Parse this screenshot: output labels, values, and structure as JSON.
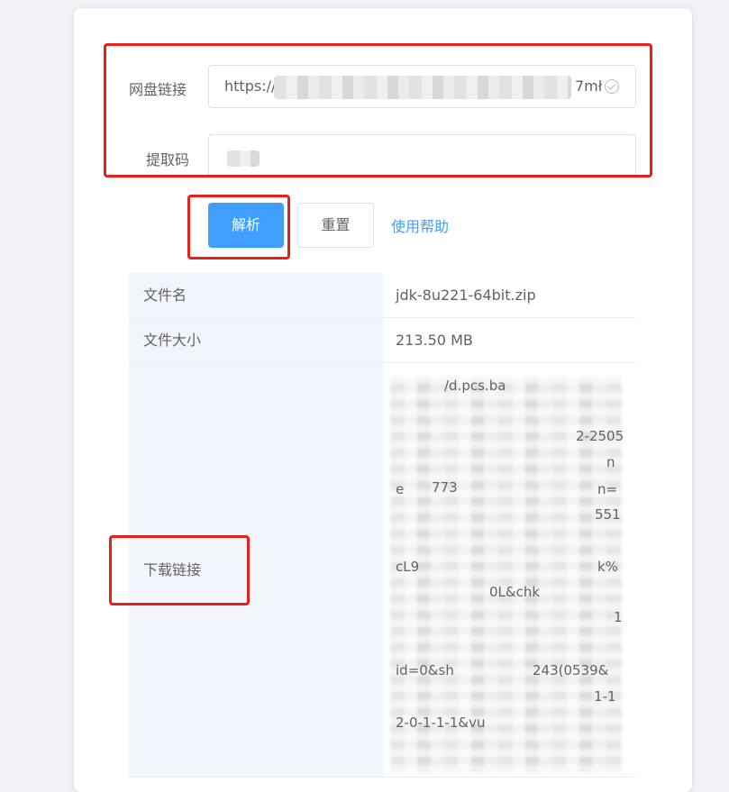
{
  "form": {
    "link_label": "网盘链接",
    "link_value_visible_start": "https://",
    "link_value_visible_end": "7mł",
    "code_label": "提取码"
  },
  "actions": {
    "parse_label": "解析",
    "reset_label": "重置",
    "help_label": "使用帮助"
  },
  "table": {
    "rows": [
      {
        "label": "文件名",
        "value": "jdk-8u221-64bit.zip"
      },
      {
        "label": "文件大小",
        "value": "213.50 MB"
      },
      {
        "label": "下载链接",
        "value": ""
      }
    ],
    "download_link_fragments": [
      "/d.pcs.ba",
      "2-2505",
      "n",
      "e",
      "773",
      "n=",
      "551",
      "cL9",
      "k%",
      "0L&chk",
      "1",
      "id=0&sh",
      "243(0539&",
      "1-1",
      "2-0-1-1-1&vu"
    ]
  },
  "colors": {
    "primary": "#409eff",
    "highlight": "#e8201a",
    "label_bg": "#f2f6fc"
  }
}
